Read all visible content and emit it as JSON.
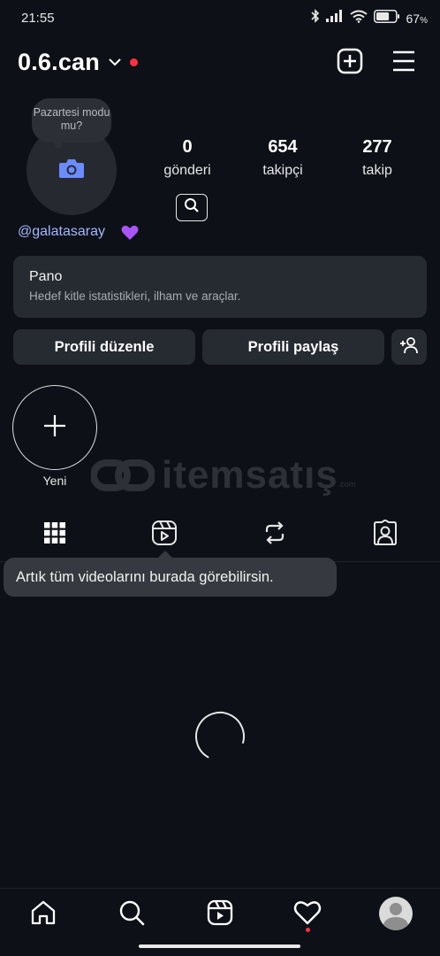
{
  "status_bar": {
    "time": "21:55",
    "battery_percent": "67",
    "battery_unit": "%",
    "battery_level": 0.67,
    "icons": [
      "bluetooth-icon",
      "signal-icon",
      "wifi-icon",
      "battery-icon"
    ]
  },
  "header": {
    "username": "0.6.can",
    "notification_dot_color": "#ff3040",
    "icons": [
      "new-post-icon",
      "menu-icon"
    ]
  },
  "profile": {
    "note_text": "Pazartesi modu mu?",
    "stats": [
      {
        "value": "0",
        "label": "gönderi"
      },
      {
        "value": "654",
        "label": "takipçi"
      },
      {
        "value": "277",
        "label": "takip"
      }
    ],
    "bio_link": "@galatasaray",
    "bio_emoji": "💜",
    "link_color": "#a3b6ff",
    "camera_icon_color": "#6b8cff"
  },
  "dashboard": {
    "title": "Pano",
    "subtitle": "Hedef kitle istatistikleri, ilham ve araçlar."
  },
  "actions": {
    "edit_profile": "Profili düzenle",
    "share_profile": "Profili paylaş"
  },
  "highlights": {
    "new_label": "Yeni"
  },
  "watermark": {
    "text": "itemsatış",
    "suffix": ".com"
  },
  "tabs": [
    "grid-icon",
    "reels-icon",
    "reposts-icon",
    "tagged-icon"
  ],
  "tooltip": {
    "text": "Artık tüm videolarını burada görebilirsin."
  },
  "bottom_nav": [
    "home-icon",
    "search-icon",
    "reels-icon",
    "heart-icon",
    "profile-avatar"
  ]
}
